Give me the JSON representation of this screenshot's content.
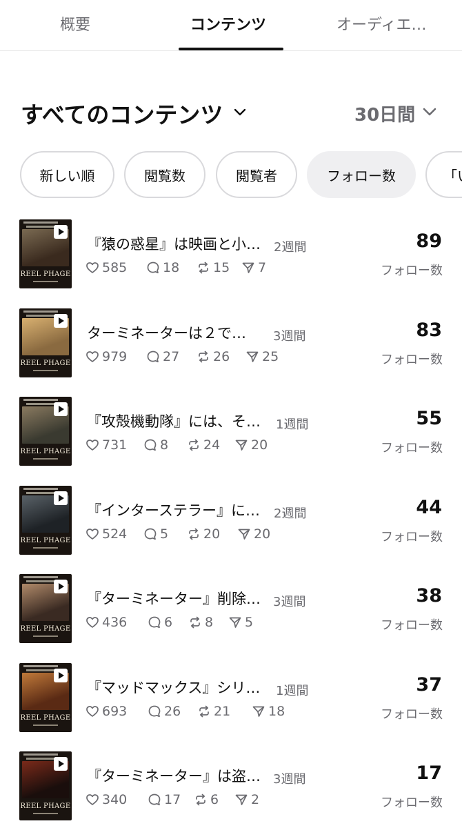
{
  "tabs": [
    {
      "label": "概要"
    },
    {
      "label": "コンテンツ"
    },
    {
      "label": "オーディエ…"
    }
  ],
  "header": {
    "title": "すべてのコンテンツ",
    "period": "30日間"
  },
  "chips": [
    {
      "label": "新しい順"
    },
    {
      "label": "閲覧数"
    },
    {
      "label": "閲覧者"
    },
    {
      "label": "フォロー数"
    },
    {
      "label": "「い"
    }
  ],
  "thumb_brand": "REEL PHAGE",
  "posts": [
    {
      "title": "『猿の惑星』は映画と小…",
      "ago": "2週間",
      "likes": "585",
      "replies": "18",
      "reposts": "15",
      "shares": "7",
      "count": "89",
      "count_label": "フォロー数",
      "thumb_colors": [
        "#3a2a1e",
        "#7a6a52"
      ]
    },
    {
      "title": "ターミネーターは２で…",
      "ago": "3週間",
      "likes": "979",
      "replies": "27",
      "reposts": "26",
      "shares": "25",
      "count": "83",
      "count_label": "フォロー数",
      "thumb_colors": [
        "#8a6a40",
        "#d8b070"
      ]
    },
    {
      "title": "『攻殻機動隊』には、そ…",
      "ago": "1週間",
      "likes": "731",
      "replies": "8",
      "reposts": "24",
      "shares": "20",
      "count": "55",
      "count_label": "フォロー数",
      "thumb_colors": [
        "#3a3a30",
        "#8a7a60"
      ]
    },
    {
      "title": "『インターステラー』に…",
      "ago": "2週間",
      "likes": "524",
      "replies": "5",
      "reposts": "20",
      "shares": "20",
      "count": "44",
      "count_label": "フォロー数",
      "thumb_colors": [
        "#1e2226",
        "#5a6268"
      ]
    },
    {
      "title": "『ターミネーター』削除…",
      "ago": "3週間",
      "likes": "436",
      "replies": "6",
      "reposts": "8",
      "shares": "5",
      "count": "38",
      "count_label": "フォロー数",
      "thumb_colors": [
        "#3a2a22",
        "#b08a6a"
      ]
    },
    {
      "title": "『マッドマックス』シリ…",
      "ago": "1週間",
      "likes": "693",
      "replies": "26",
      "reposts": "21",
      "shares": "18",
      "count": "37",
      "count_label": "フォロー数",
      "thumb_colors": [
        "#5a2a14",
        "#c07a3a"
      ]
    },
    {
      "title": "『ターミネーター』は盗…",
      "ago": "3週間",
      "likes": "340",
      "replies": "17",
      "reposts": "6",
      "shares": "2",
      "count": "17",
      "count_label": "フォロー数",
      "thumb_colors": [
        "#1a0e0c",
        "#7a2a1a"
      ]
    }
  ]
}
